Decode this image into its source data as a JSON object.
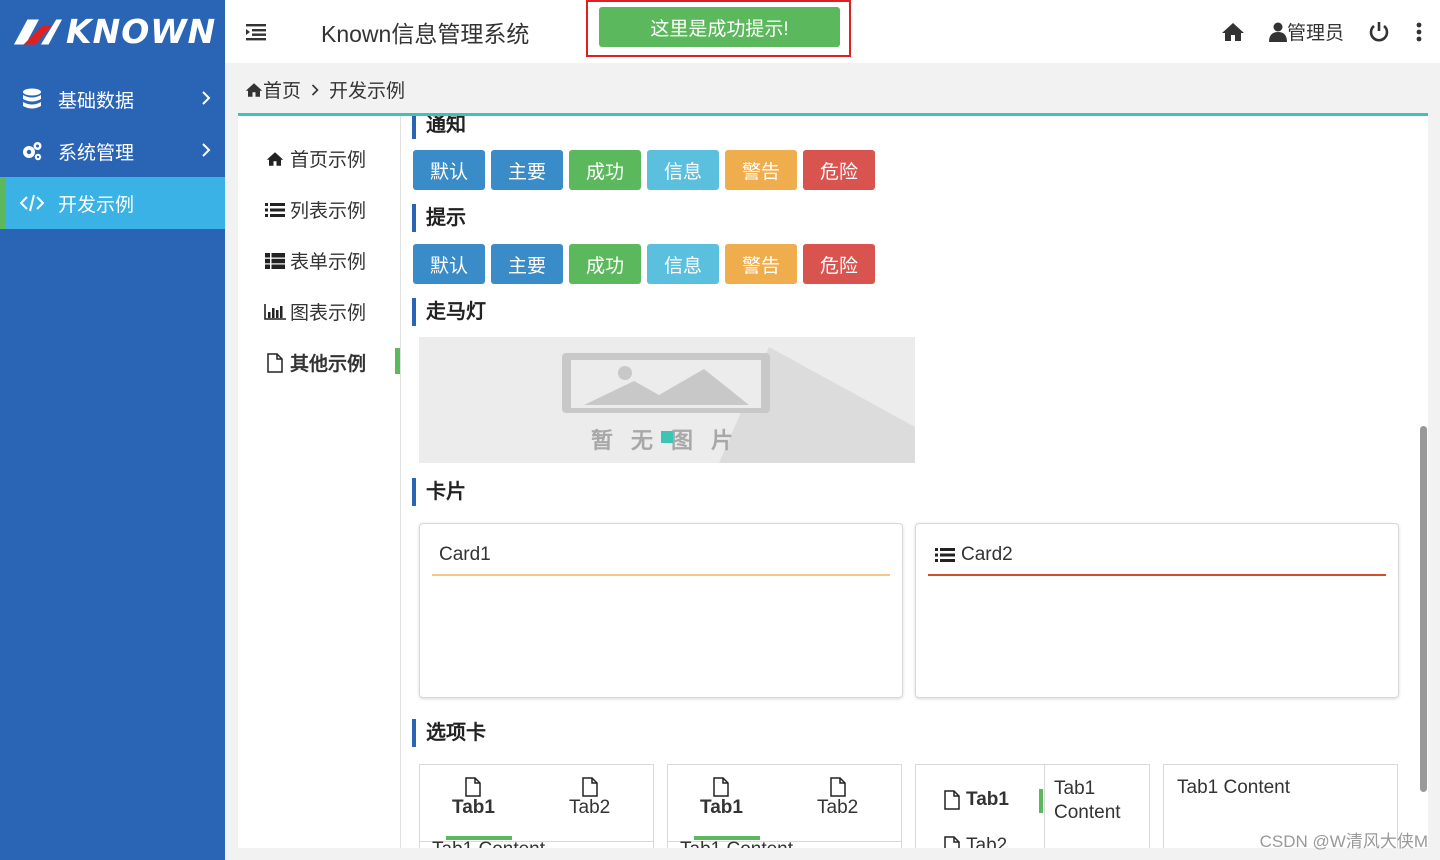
{
  "logo": {
    "text": "KNOWN"
  },
  "sidebar": {
    "items": [
      {
        "label": "基础数据",
        "icon": "database-icon"
      },
      {
        "label": "系统管理",
        "icon": "cogs-icon"
      },
      {
        "label": "开发示例",
        "icon": "code-icon",
        "active": true
      }
    ]
  },
  "header": {
    "title": "Known信息管理系统",
    "toast": "这里是成功提示!",
    "user": "管理员"
  },
  "breadcrumb": {
    "home": "首页",
    "current": "开发示例"
  },
  "subnav": {
    "items": [
      {
        "label": "首页示例",
        "icon": "home-icon"
      },
      {
        "label": "列表示例",
        "icon": "list-icon"
      },
      {
        "label": "表单示例",
        "icon": "th-list-icon"
      },
      {
        "label": "图表示例",
        "icon": "bar-chart-icon"
      },
      {
        "label": "其他示例",
        "icon": "file-icon",
        "active": true
      }
    ]
  },
  "sections": {
    "notice": "通知",
    "tips": "提示",
    "carousel": "走马灯",
    "cards": "卡片",
    "tabs": "选项卡"
  },
  "buttons": [
    {
      "label": "默认",
      "color": "#3a8cc9"
    },
    {
      "label": "主要",
      "color": "#3a8cc9"
    },
    {
      "label": "成功",
      "color": "#5cb85c"
    },
    {
      "label": "信息",
      "color": "#5bc0de"
    },
    {
      "label": "警告",
      "color": "#f0ad4e"
    },
    {
      "label": "危险",
      "color": "#d9534f"
    }
  ],
  "carousel": {
    "placeholder": "暂无图片"
  },
  "cards": [
    {
      "title": "Card1",
      "accent": "#f5c58a"
    },
    {
      "title": "Card2",
      "accent": "#d0502a"
    }
  ],
  "tabs": {
    "tab1": "Tab1",
    "tab2": "Tab2",
    "content1": "Tab1 Content",
    "content1_wrap_a": "Tab1",
    "content1_wrap_b": "Content"
  },
  "colors": {
    "sidebar": "#2a64b5",
    "active": "#3ab2e6",
    "success": "#5cb85c",
    "panel_top": "#3cc4b4"
  },
  "watermark": "CSDN @W清风大侠M"
}
